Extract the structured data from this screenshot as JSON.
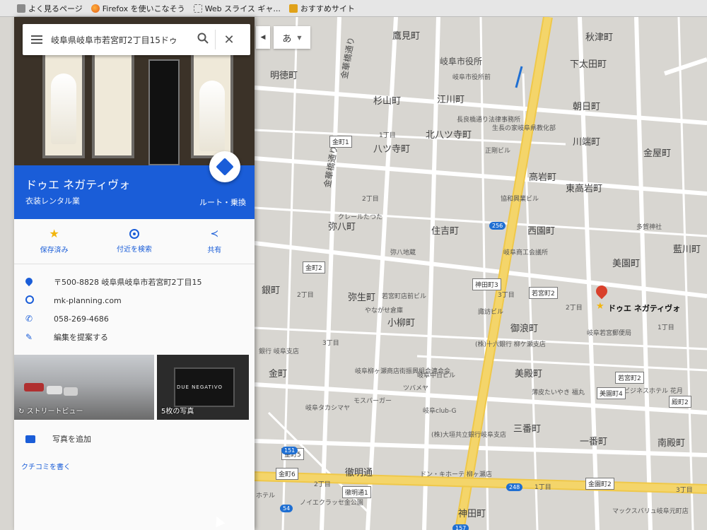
{
  "bookmarks": {
    "items": [
      "よく見るページ",
      "Firefox を使いこなそう",
      "Web スライス ギャ...",
      "おすすめサイト"
    ]
  },
  "search": {
    "value": "岐阜県岐阜市若宮町2丁目15ドゥ"
  },
  "ime": {
    "label": "あ"
  },
  "place": {
    "name": "ドゥエ ネガティヴォ",
    "category": "衣装レンタル業",
    "route_label": "ルート・乗換",
    "photo_brand": "DUE NEGATIVO"
  },
  "actions": {
    "saved": "保存済み",
    "nearby": "付近を検索",
    "share": "共有"
  },
  "info": {
    "address": "〒500-8828 岐阜県岐阜市若宮町2丁目15",
    "website": "mk-planning.com",
    "phone": "058-269-4686",
    "suggest_edit": "編集を提案する"
  },
  "photos": {
    "street_view": "ストリートビュー",
    "photo_count": "5枚の写真"
  },
  "add_photo": "写真を追加",
  "write_review": "クチコミを書く",
  "map": {
    "marker_label": "ドゥエ ネガティヴォ",
    "labels": [
      "鷹見町",
      "秋津町",
      "明徳町",
      "岐阜市役所",
      "下太田町",
      "杉山町",
      "江川町",
      "朝日町",
      "北八ツ寺町",
      "八ツ寺町",
      "川端町",
      "金屋町",
      "高岩町",
      "東高岩町",
      "弥八町",
      "住吉町",
      "西園町",
      "美園町",
      "藍川町",
      "銀町",
      "弥生町",
      "御浪町",
      "小柳町",
      "金町",
      "美殿町",
      "三番町",
      "一番町",
      "南殿町",
      "徹明通",
      "神田町",
      "弥八地蔵"
    ],
    "small_labels": [
      "岐阜市役所前",
      "長良橋通り法律事務所",
      "生長の家岐阜県教化部",
      "正剛ビル",
      "協和興業ビル",
      "クレールたつた",
      "岐阜商工会議所",
      "若宮町店前ビル",
      "やながせ倉庫",
      "諏訪ビル",
      "岐阜若宮郵便局",
      "銀行 岐阜支店",
      "(株)十六銀行 柳ケ瀬支店",
      "岐阜柳ヶ瀬商店街振興組合連合会",
      "岐阜中日ビル",
      "ツバメヤ",
      "モスバーガー",
      "岐阜タカシマヤ",
      "岐阜club-G",
      "(株)大垣共立銀行岐阜支店",
      "ドン・キホーテ 柳ヶ瀬店",
      "薄皮たいやき 福丸",
      "ビジネスホテル 花月",
      "多賀神社",
      "マックスバリュ岐阜元町店",
      "ノイエクラッセ金公園",
      "ホテル"
    ],
    "shields": [
      "金町1",
      "金町2",
      "神田町3",
      "若宮町2",
      "金町5",
      "金町6",
      "若宮町2",
      "美園町4",
      "徹明通1",
      "金園町2",
      "殿町2"
    ],
    "routes": [
      "256",
      "151",
      "248",
      "54",
      "157"
    ],
    "road_names": [
      "金華橋通り",
      "金華橋通り"
    ],
    "chome": [
      "1丁目",
      "2丁目",
      "3丁目"
    ]
  }
}
